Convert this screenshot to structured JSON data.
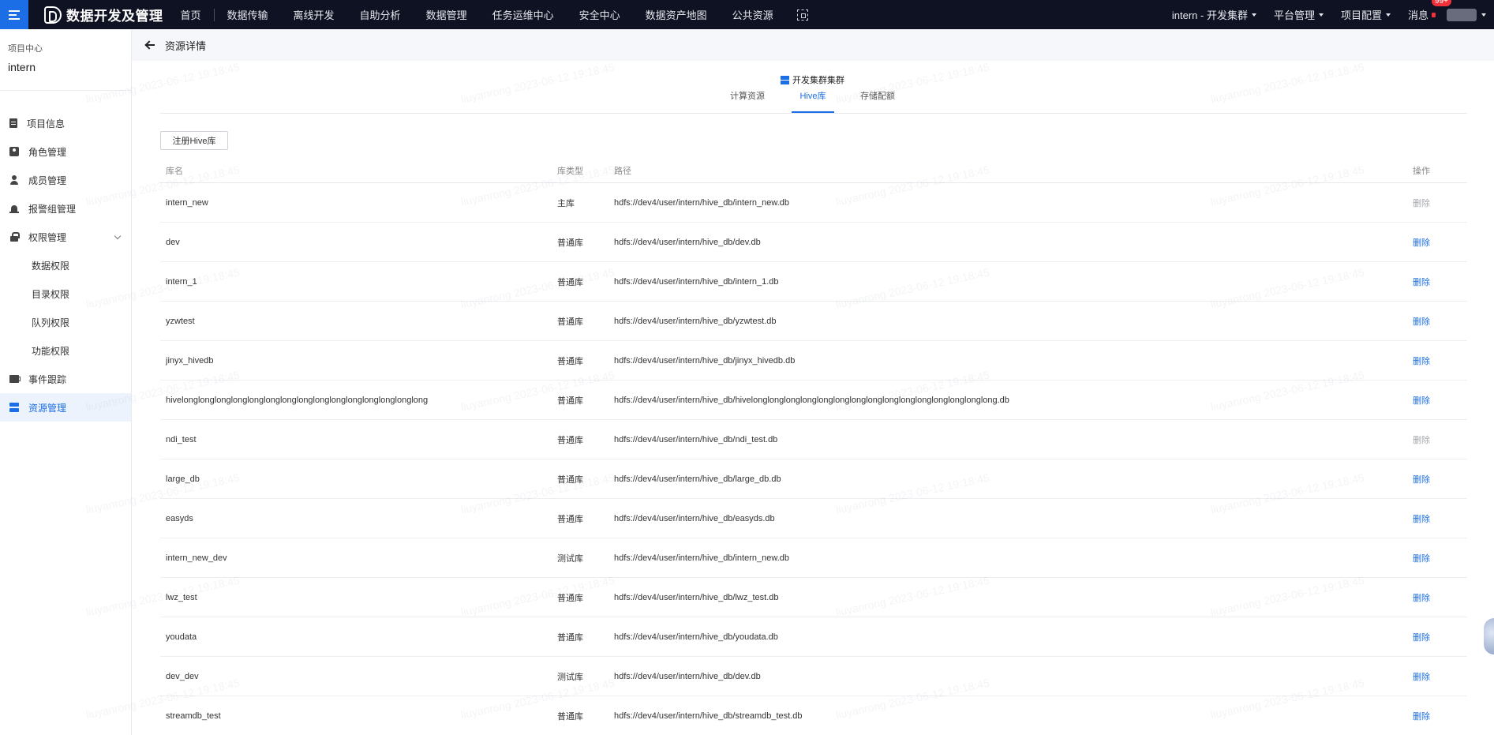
{
  "topbar": {
    "app_title": "数据开发及管理",
    "nav": [
      "首页",
      "数据传输",
      "离线开发",
      "自助分析",
      "数据管理",
      "任务运维中心",
      "安全中心",
      "数据资产地图",
      "公共资源"
    ],
    "cluster_selector": "intern - 开发集群",
    "platform_mgmt": "平台管理",
    "project_config": "项目配置",
    "messages": "消息",
    "message_badge": "99+"
  },
  "sidebar": {
    "section_label": "项目中心",
    "project_name": "intern",
    "items": [
      {
        "label": "项目信息",
        "icon": "document-icon"
      },
      {
        "label": "角色管理",
        "icon": "role-icon"
      },
      {
        "label": "成员管理",
        "icon": "user-icon"
      },
      {
        "label": "报警组管理",
        "icon": "alarm-icon"
      },
      {
        "label": "权限管理",
        "icon": "lock-icon"
      },
      {
        "label": "数据权限",
        "sub": true
      },
      {
        "label": "目录权限",
        "sub": true
      },
      {
        "label": "队列权限",
        "sub": true
      },
      {
        "label": "功能权限",
        "sub": true
      },
      {
        "label": "事件跟踪",
        "icon": "event-icon"
      },
      {
        "label": "资源管理",
        "icon": "resource-icon",
        "active": true
      }
    ]
  },
  "page": {
    "title": "资源详情",
    "cluster_label": "开发集群集群",
    "tabs": [
      "计算资源",
      "Hive库",
      "存储配额"
    ],
    "active_tab": "Hive库",
    "register_button": "注册Hive库"
  },
  "table": {
    "headers": {
      "name": "库名",
      "type": "库类型",
      "path": "路径",
      "op": "操作"
    },
    "rows": [
      {
        "name": "intern_new",
        "type": "主库",
        "path": "hdfs://dev4/user/intern/hive_db/intern_new.db",
        "op": "删除",
        "op_disabled": true
      },
      {
        "name": "dev",
        "type": "普通库",
        "path": "hdfs://dev4/user/intern/hive_db/dev.db",
        "op": "删除",
        "op_disabled": false
      },
      {
        "name": "intern_1",
        "type": "普通库",
        "path": "hdfs://dev4/user/intern/hive_db/intern_1.db",
        "op": "删除",
        "op_disabled": false
      },
      {
        "name": "yzwtest",
        "type": "普通库",
        "path": "hdfs://dev4/user/intern/hive_db/yzwtest.db",
        "op": "删除",
        "op_disabled": false
      },
      {
        "name": "jinyx_hivedb",
        "type": "普通库",
        "path": "hdfs://dev4/user/intern/hive_db/jinyx_hivedb.db",
        "op": "删除",
        "op_disabled": false
      },
      {
        "name": "hivelonglonglonglonglonglonglonglonglonglonglonglonglonglonglong",
        "type": "普通库",
        "path": "hdfs://dev4/user/intern/hive_db/hivelonglonglonglonglonglonglonglonglonglonglonglonglonglonglong.db",
        "op": "删除",
        "op_disabled": false
      },
      {
        "name": "ndi_test",
        "type": "普通库",
        "path": "hdfs://dev4/user/intern/hive_db/ndi_test.db",
        "op": "删除",
        "op_disabled": true
      },
      {
        "name": "large_db",
        "type": "普通库",
        "path": "hdfs://dev4/user/intern/hive_db/large_db.db",
        "op": "删除",
        "op_disabled": false
      },
      {
        "name": "easyds",
        "type": "普通库",
        "path": "hdfs://dev4/user/intern/hive_db/easyds.db",
        "op": "删除",
        "op_disabled": false
      },
      {
        "name": "intern_new_dev",
        "type": "测试库",
        "path": "hdfs://dev4/user/intern/hive_db/intern_new.db",
        "op": "删除",
        "op_disabled": false
      },
      {
        "name": "lwz_test",
        "type": "普通库",
        "path": "hdfs://dev4/user/intern/hive_db/lwz_test.db",
        "op": "删除",
        "op_disabled": false
      },
      {
        "name": "youdata",
        "type": "普通库",
        "path": "hdfs://dev4/user/intern/hive_db/youdata.db",
        "op": "删除",
        "op_disabled": false
      },
      {
        "name": "dev_dev",
        "type": "测试库",
        "path": "hdfs://dev4/user/intern/hive_db/dev.db",
        "op": "删除",
        "op_disabled": false
      },
      {
        "name": "streamdb_test",
        "type": "普通库",
        "path": "hdfs://dev4/user/intern/hive_db/streamdb_test.db",
        "op": "删除",
        "op_disabled": false
      }
    ]
  },
  "watermark": "liuyanrong 2023-06-12 19:18:45",
  "colors": {
    "accent": "#1b6ee5",
    "topbar": "#0f1222",
    "badge": "#f0313a"
  }
}
